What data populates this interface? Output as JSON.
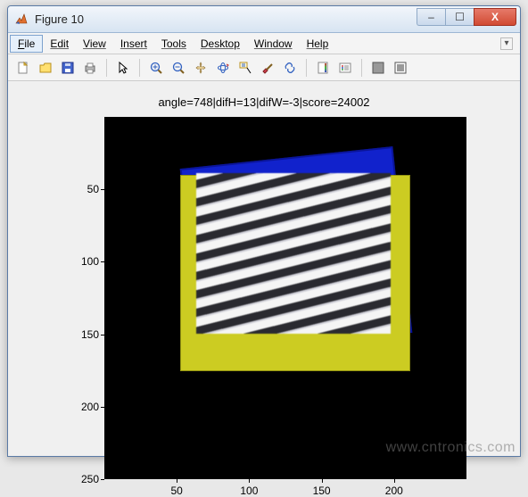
{
  "window": {
    "title": "Figure 10",
    "controls": {
      "min": "–",
      "max": "☐",
      "close": "X"
    }
  },
  "menubar": {
    "items": [
      "File",
      "Edit",
      "View",
      "Insert",
      "Tools",
      "Desktop",
      "Window",
      "Help"
    ]
  },
  "toolbar": {
    "icons": [
      "new-file-icon",
      "open-file-icon",
      "save-icon",
      "print-icon",
      "pointer-icon",
      "zoom-in-icon",
      "zoom-out-icon",
      "pan-icon",
      "rotate3d-icon",
      "data-cursor-icon",
      "brush-icon",
      "link-icon",
      "colorbar-icon",
      "legend-icon",
      "hide-plot-icon",
      "show-plot-icon"
    ]
  },
  "figure": {
    "title": "angle=748|difH=13|difW=-3|score=24002",
    "xlim": [
      1,
      250
    ],
    "ylim": [
      1,
      250
    ],
    "xticks": [
      50,
      100,
      150,
      200
    ],
    "yticks": [
      50,
      100,
      150,
      200,
      250
    ]
  },
  "chart_data": {
    "type": "image",
    "title": "angle=748|difH=13|difW=-3|score=24002",
    "xlim": [
      1,
      250
    ],
    "ylim": [
      1,
      250
    ],
    "y_reversed": true,
    "overlays": [
      {
        "name": "blue-quad",
        "color": "#1122cc",
        "approx_rect": {
          "x": 60,
          "y": 30,
          "w": 150,
          "h": 130
        },
        "rotation_deg": -6
      },
      {
        "name": "yellow-quad",
        "color": "#cccc22",
        "approx_rect": {
          "x": 55,
          "y": 45,
          "w": 160,
          "h": 140
        },
        "rotation_deg": 0
      },
      {
        "name": "striped-image",
        "pattern": "diagonal-stripes",
        "stripe_angle_deg": -14,
        "approx_rect": {
          "x": 67,
          "y": 43,
          "w": 135,
          "h": 115
        }
      }
    ],
    "params": {
      "angle": 748,
      "difH": 13,
      "difW": -3,
      "score": 24002
    }
  },
  "watermark": "www.cntronics.com"
}
